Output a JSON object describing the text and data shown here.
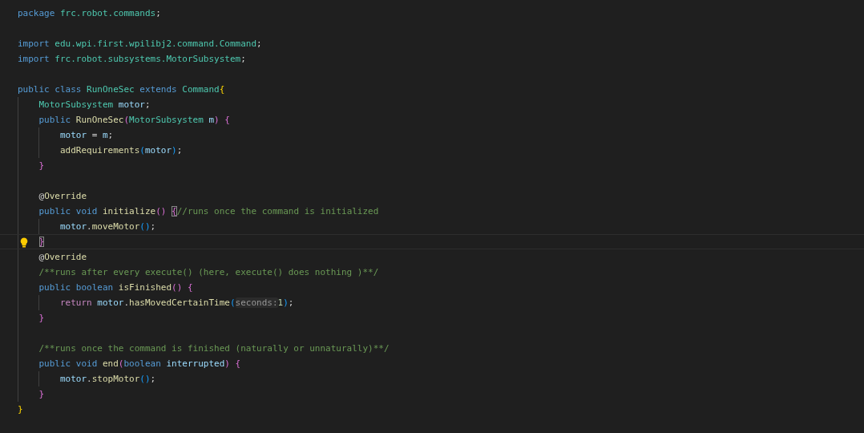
{
  "editor": {
    "lines": [
      {
        "blank_before": false,
        "tokens": [
          {
            "t": "package ",
            "kind": "keyword"
          },
          {
            "t": "frc.robot.commands",
            "kind": "type"
          },
          {
            "t": ";",
            "kind": "plain"
          }
        ]
      },
      {
        "blank_before": true,
        "tokens": [
          {
            "t": "import ",
            "kind": "keyword"
          },
          {
            "t": "edu.wpi.first.wpilibj2.command.Command",
            "kind": "type"
          },
          {
            "t": ";",
            "kind": "plain"
          }
        ]
      },
      {
        "blank_before": false,
        "tokens": [
          {
            "t": "import ",
            "kind": "keyword"
          },
          {
            "t": "frc.robot.subsystems.MotorSubsystem",
            "kind": "type"
          },
          {
            "t": ";",
            "kind": "plain"
          }
        ]
      },
      {
        "blank_before": true,
        "tokens": [
          {
            "t": "public class ",
            "kind": "keyword"
          },
          {
            "t": "RunOneSec ",
            "kind": "type"
          },
          {
            "t": "extends ",
            "kind": "keyword"
          },
          {
            "t": "Command",
            "kind": "type"
          },
          {
            "t": "{",
            "kind": "bracket1"
          }
        ]
      },
      {
        "blank_before": false,
        "tokens": [
          {
            "t": "    MotorSubsystem ",
            "kind": "type"
          },
          {
            "t": "motor",
            "kind": "variable"
          },
          {
            "t": ";",
            "kind": "plain"
          }
        ]
      },
      {
        "blank_before": false,
        "tokens": [
          {
            "t": "    public ",
            "kind": "keyword"
          },
          {
            "t": "RunOneSec",
            "kind": "function"
          },
          {
            "t": "(",
            "kind": "bracket2"
          },
          {
            "t": "MotorSubsystem ",
            "kind": "type"
          },
          {
            "t": "m",
            "kind": "variable"
          },
          {
            "t": ") {",
            "kind": "bracket2"
          }
        ]
      },
      {
        "blank_before": false,
        "tokens": [
          {
            "t": "        motor",
            "kind": "variable"
          },
          {
            "t": " = ",
            "kind": "plain"
          },
          {
            "t": "m",
            "kind": "variable"
          },
          {
            "t": ";",
            "kind": "plain"
          }
        ]
      },
      {
        "blank_before": false,
        "tokens": [
          {
            "t": "        addRequirements",
            "kind": "function"
          },
          {
            "t": "(",
            "kind": "bracket3"
          },
          {
            "t": "motor",
            "kind": "variable"
          },
          {
            "t": ")",
            "kind": "bracket3"
          },
          {
            "t": ";",
            "kind": "plain"
          }
        ]
      },
      {
        "blank_before": false,
        "tokens": [
          {
            "t": "    }",
            "kind": "bracket2"
          }
        ]
      },
      {
        "blank_before": true,
        "tokens": [
          {
            "t": "    @",
            "kind": "plain"
          },
          {
            "t": "Override",
            "kind": "annotation"
          }
        ]
      },
      {
        "blank_before": false,
        "tokens": [
          {
            "t": "    public void ",
            "kind": "keyword"
          },
          {
            "t": "initialize",
            "kind": "function"
          },
          {
            "t": "() ",
            "kind": "bracket2"
          },
          {
            "t": "{",
            "kind": "bracket2",
            "boxed": true
          },
          {
            "t": "//runs once the command is initialized",
            "kind": "comment"
          }
        ]
      },
      {
        "blank_before": false,
        "tokens": [
          {
            "t": "        motor",
            "kind": "variable"
          },
          {
            "t": ".",
            "kind": "plain"
          },
          {
            "t": "moveMotor",
            "kind": "function"
          },
          {
            "t": "()",
            "kind": "bracket3"
          },
          {
            "t": ";",
            "kind": "plain"
          }
        ]
      },
      {
        "blank_before": false,
        "current": true,
        "lightbulb": true,
        "tokens": [
          {
            "t": "    }",
            "kind": "bracket2",
            "boxed": true
          }
        ]
      },
      {
        "blank_before": false,
        "tokens": [
          {
            "t": "    @",
            "kind": "plain"
          },
          {
            "t": "Override",
            "kind": "annotation"
          }
        ]
      },
      {
        "blank_before": false,
        "tokens": [
          {
            "t": "    /**runs after every execute() (here, execute() does nothing )**/",
            "kind": "comment"
          }
        ]
      },
      {
        "blank_before": false,
        "tokens": [
          {
            "t": "    public boolean ",
            "kind": "keyword"
          },
          {
            "t": "isFinished",
            "kind": "function"
          },
          {
            "t": "() {",
            "kind": "bracket2"
          }
        ]
      },
      {
        "blank_before": false,
        "tokens": [
          {
            "t": "        return ",
            "kind": "control"
          },
          {
            "t": "motor",
            "kind": "variable"
          },
          {
            "t": ".",
            "kind": "plain"
          },
          {
            "t": "hasMovedCertainTime",
            "kind": "function"
          },
          {
            "t": "(",
            "kind": "bracket3"
          },
          {
            "t": "seconds:",
            "kind": "hint"
          },
          {
            "t": "1",
            "kind": "number"
          },
          {
            "t": ")",
            "kind": "bracket3"
          },
          {
            "t": ";",
            "kind": "plain"
          }
        ]
      },
      {
        "blank_before": false,
        "tokens": [
          {
            "t": "    }",
            "kind": "bracket2"
          }
        ]
      },
      {
        "blank_before": true,
        "tokens": [
          {
            "t": "    /**runs once the command is finished (naturally or unnaturally)**/",
            "kind": "comment"
          }
        ]
      },
      {
        "blank_before": false,
        "tokens": [
          {
            "t": "    public void ",
            "kind": "keyword"
          },
          {
            "t": "end",
            "kind": "function"
          },
          {
            "t": "(",
            "kind": "bracket2"
          },
          {
            "t": "boolean ",
            "kind": "keyword"
          },
          {
            "t": "interrupted",
            "kind": "variable"
          },
          {
            "t": ") {",
            "kind": "bracket2"
          }
        ]
      },
      {
        "blank_before": false,
        "tokens": [
          {
            "t": "        motor",
            "kind": "variable"
          },
          {
            "t": ".",
            "kind": "plain"
          },
          {
            "t": "stopMotor",
            "kind": "function"
          },
          {
            "t": "()",
            "kind": "bracket3"
          },
          {
            "t": ";",
            "kind": "plain"
          }
        ]
      },
      {
        "blank_before": false,
        "tokens": [
          {
            "t": "    }",
            "kind": "bracket2"
          }
        ]
      },
      {
        "blank_before": false,
        "tokens": [
          {
            "t": "}",
            "kind": "bracket1"
          }
        ]
      }
    ]
  }
}
